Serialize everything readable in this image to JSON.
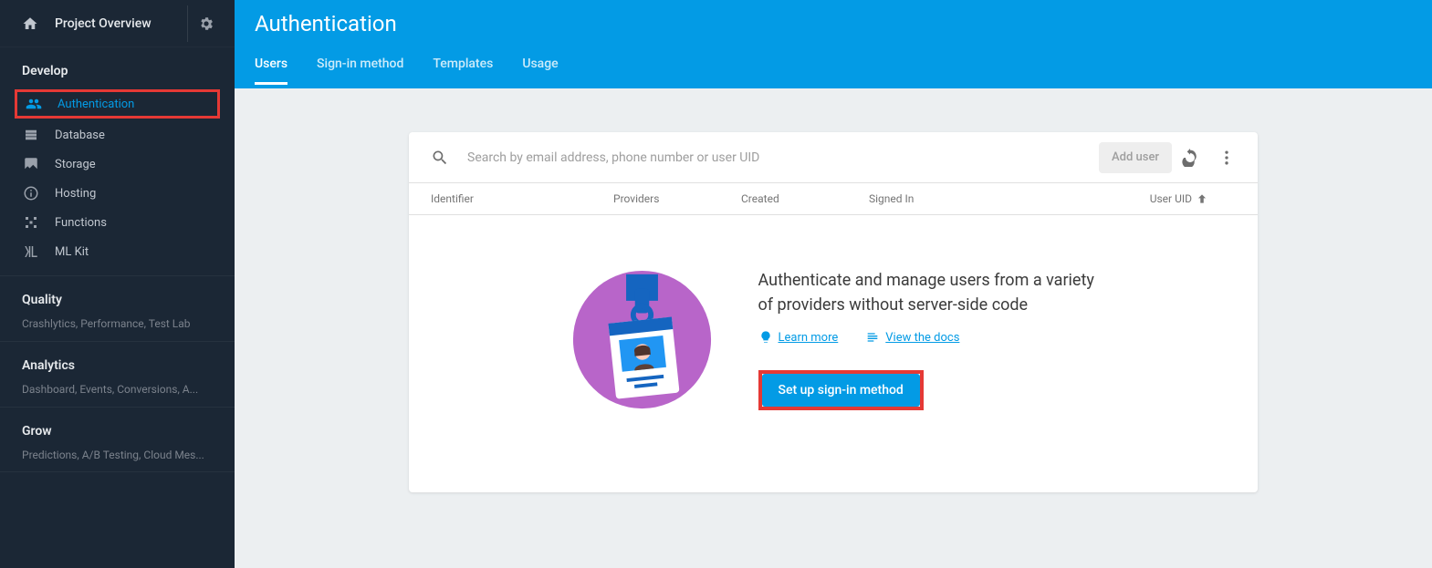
{
  "sidebar": {
    "overview_label": "Project Overview",
    "sections": {
      "develop": {
        "title": "Develop",
        "items": [
          {
            "label": "Authentication"
          },
          {
            "label": "Database"
          },
          {
            "label": "Storage"
          },
          {
            "label": "Hosting"
          },
          {
            "label": "Functions"
          },
          {
            "label": "ML Kit"
          }
        ]
      },
      "quality": {
        "title": "Quality",
        "sub": "Crashlytics, Performance, Test Lab"
      },
      "analytics": {
        "title": "Analytics",
        "sub": "Dashboard, Events, Conversions, A..."
      },
      "grow": {
        "title": "Grow",
        "sub": "Predictions, A/B Testing, Cloud Mes..."
      }
    }
  },
  "header": {
    "title": "Authentication",
    "tabs": [
      {
        "label": "Users"
      },
      {
        "label": "Sign-in method"
      },
      {
        "label": "Templates"
      },
      {
        "label": "Usage"
      }
    ]
  },
  "toolbar": {
    "search_placeholder": "Search by email address, phone number or user UID",
    "add_user_label": "Add user"
  },
  "table": {
    "cols": {
      "identifier": "Identifier",
      "providers": "Providers",
      "created": "Created",
      "signed_in": "Signed In",
      "user_uid": "User UID"
    }
  },
  "empty": {
    "title": "Authenticate and manage users from a variety of providers without server-side code",
    "learn_more": "Learn more",
    "view_docs": "View the docs",
    "cta": "Set up sign-in method"
  }
}
